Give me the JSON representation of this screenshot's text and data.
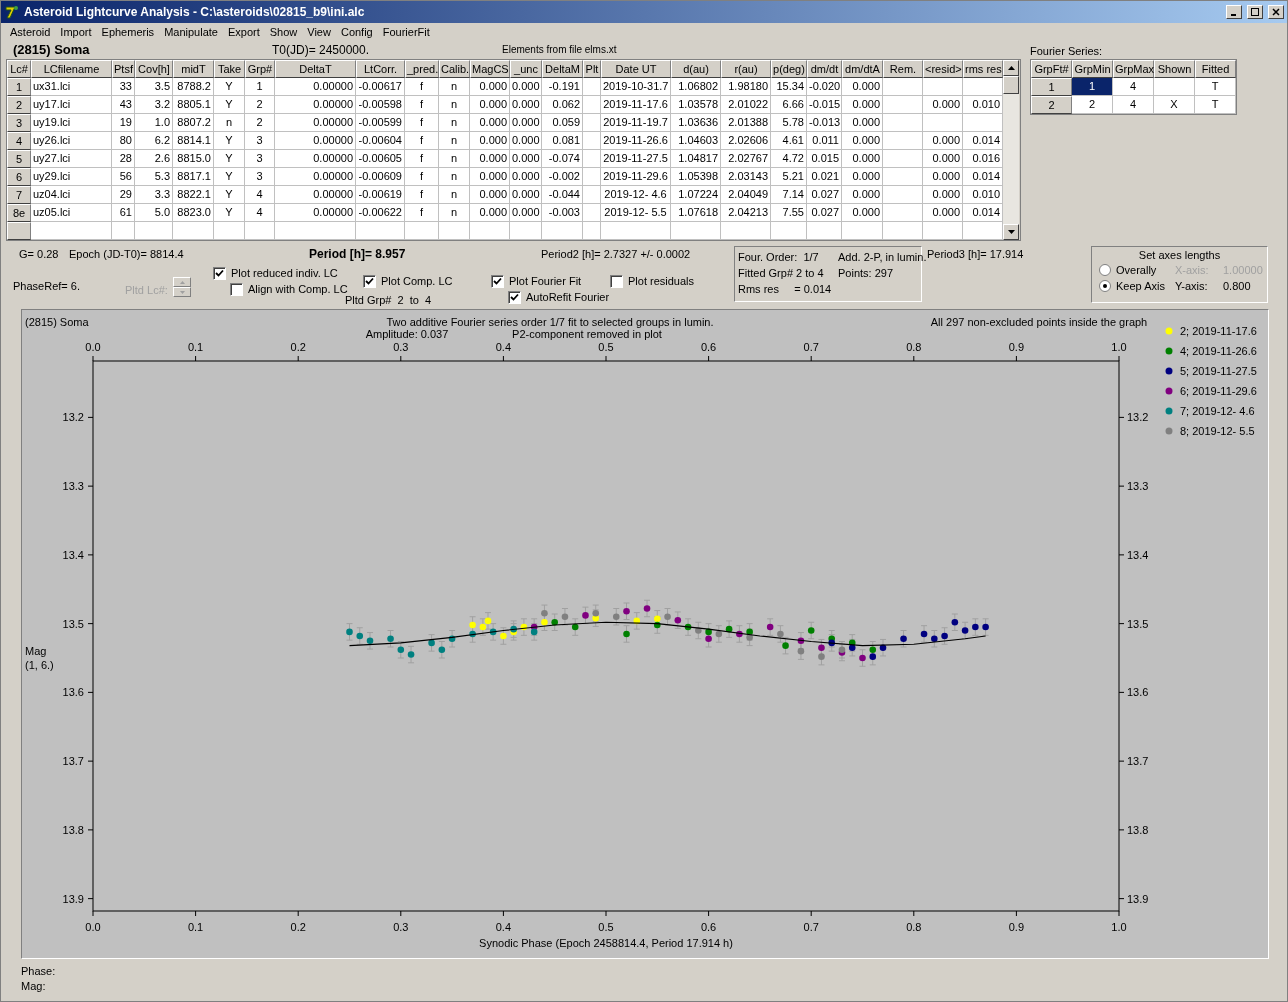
{
  "window": {
    "title": "Asteroid Lightcurve Analysis - C:\\asteroids\\02815_b9\\ini.alc"
  },
  "menu": [
    "Asteroid",
    "Import",
    "Ephemeris",
    "Manipulate",
    "Export",
    "Show",
    "View",
    "Config",
    "FourierFit"
  ],
  "header": {
    "object": "(2815) Soma",
    "t0": "T0(JD)= 2450000.",
    "elements": "Elements from file elms.xt"
  },
  "lc_table": {
    "columns": [
      "Lc#",
      "LCfilename",
      "Ptsf",
      "Cov[h]",
      "midT",
      "Take",
      "Grp#",
      "DeltaT",
      "LtCorr.",
      "_pred.",
      "Calib.",
      "MagCS",
      "_unc",
      "DeltaM",
      "Plt",
      "Date UT",
      "d(au)",
      "r(au)",
      "p(deg)",
      "dm/dt",
      "dm/dtA",
      "Rem.",
      "<resid>",
      "rms res"
    ],
    "rows": [
      {
        "cells": [
          "1",
          "ux31.lci",
          "33",
          "3.5",
          "8788.2",
          "Y",
          "1",
          "0.00000",
          "-0.00617",
          "f",
          "n",
          "0.000",
          "0.000",
          "-0.191",
          "",
          "2019-10-31.7",
          "1.06802",
          "1.98180",
          "15.34",
          "-0.020",
          "0.000",
          "",
          "",
          ""
        ]
      },
      {
        "cells": [
          "2",
          "uy17.lci",
          "43",
          "3.2",
          "8805.1",
          "Y",
          "2",
          "0.00000",
          "-0.00598",
          "f",
          "n",
          "0.000",
          "0.000",
          "0.062",
          "",
          "2019-11-17.6",
          "1.03578",
          "2.01022",
          "6.66",
          "-0.015",
          "0.000",
          "",
          "0.000",
          "0.010"
        ]
      },
      {
        "cells": [
          "3",
          "uy19.lci",
          "19",
          "1.0",
          "8807.2",
          "n",
          "2",
          "0.00000",
          "-0.00599",
          "f",
          "n",
          "0.000",
          "0.000",
          "0.059",
          "",
          "2019-11-19.7",
          "1.03636",
          "2.01388",
          "5.78",
          "-0.013",
          "0.000",
          "",
          "",
          ""
        ]
      },
      {
        "cells": [
          "4",
          "uy26.lci",
          "80",
          "6.2",
          "8814.1",
          "Y",
          "3",
          "0.00000",
          "-0.00604",
          "f",
          "n",
          "0.000",
          "0.000",
          "0.081",
          "",
          "2019-11-26.6",
          "1.04603",
          "2.02606",
          "4.61",
          "0.011",
          "0.000",
          "",
          "0.000",
          "0.014"
        ]
      },
      {
        "cells": [
          "5",
          "uy27.lci",
          "28",
          "2.6",
          "8815.0",
          "Y",
          "3",
          "0.00000",
          "-0.00605",
          "f",
          "n",
          "0.000",
          "0.000",
          "-0.074",
          "",
          "2019-11-27.5",
          "1.04817",
          "2.02767",
          "4.72",
          "0.015",
          "0.000",
          "",
          "0.000",
          "0.016"
        ]
      },
      {
        "cells": [
          "6",
          "uy29.lci",
          "56",
          "5.3",
          "8817.1",
          "Y",
          "3",
          "0.00000",
          "-0.00609",
          "f",
          "n",
          "0.000",
          "0.000",
          "-0.002",
          "",
          "2019-11-29.6",
          "1.05398",
          "2.03143",
          "5.21",
          "0.021",
          "0.000",
          "",
          "0.000",
          "0.014"
        ]
      },
      {
        "cells": [
          "7",
          "uz04.lci",
          "29",
          "3.3",
          "8822.1",
          "Y",
          "4",
          "0.00000",
          "-0.00619",
          "f",
          "n",
          "0.000",
          "0.000",
          "-0.044",
          "",
          "2019-12- 4.6",
          "1.07224",
          "2.04049",
          "7.14",
          "0.027",
          "0.000",
          "",
          "0.000",
          "0.010"
        ]
      },
      {
        "cells": [
          "8e",
          "uz05.lci",
          "61",
          "5.0",
          "8823.0",
          "Y",
          "4",
          "0.00000",
          "-0.00622",
          "f",
          "n",
          "0.000",
          "0.000",
          "-0.003",
          "",
          "2019-12- 5.5",
          "1.07618",
          "2.04213",
          "7.55",
          "0.027",
          "0.000",
          "",
          "0.000",
          "0.014"
        ]
      }
    ]
  },
  "fourier": {
    "label": "Fourier Series:",
    "columns": [
      "GrpFt#",
      "GrpMin",
      "GrpMax",
      "Shown",
      "Fitted"
    ],
    "rows": [
      {
        "cells": [
          {
            "text": "1",
            "selected": false
          },
          {
            "text": "1",
            "selected": true
          },
          {
            "text": "4",
            "selected": false
          },
          {
            "text": "",
            "selected": false
          },
          {
            "text": "T",
            "selected": false
          }
        ]
      },
      {
        "cells": [
          {
            "text": "2",
            "selected": false
          },
          {
            "text": "2",
            "selected": false
          },
          {
            "text": "4",
            "selected": false
          },
          {
            "text": "X",
            "selected": false
          },
          {
            "text": "T",
            "selected": false
          }
        ]
      }
    ]
  },
  "info": {
    "g": "G= 0.28",
    "epoch": "Epoch (JD-T0)= 8814.4",
    "period": "Period [h]= 8.957",
    "period2": "Period2 [h]= 2.7327 +/- 0.0002",
    "period3": "Period3 [h]= 17.914",
    "phase_ref": "PhaseRef= 6.",
    "pltd_lc": "Pltd Lc#:",
    "pltd_grp": "Pltd Grp#  2  to  4",
    "checks": [
      {
        "label": "Plot reduced indiv. LC",
        "checked": true
      },
      {
        "label": "Align with Comp. LC",
        "checked": false
      },
      {
        "label": "Plot Comp. LC",
        "checked": true
      },
      {
        "label": "Plot Fourier Fit",
        "checked": true
      },
      {
        "label": "AutoRefit Fourier",
        "checked": true
      },
      {
        "label": "Plot residuals",
        "checked": false
      }
    ],
    "fit_box": [
      "Four. Order:  1/7",
      "Add. 2-P, in lumin.",
      "Fitted Grp# 2 to 4",
      "Points: 297",
      "Rms res     = 0.014"
    ]
  },
  "axes_box": {
    "title": "Set axes lengths",
    "options": [
      {
        "label": "Overally",
        "selected": false
      },
      {
        "label": "Keep Axis",
        "selected": true
      }
    ],
    "x_label": "X-axis:",
    "x_value": "1.00000",
    "x_disabled": true,
    "y_label": "Y-axis:",
    "y_value": "0.800"
  },
  "plot": {
    "object": "(2815) Soma",
    "title_lines": [
      "Two additive Fourier series order 1/7 fit to selected groups in lumin.",
      "P2-component removed in plot"
    ],
    "amplitude": "Amplitude: 0.037",
    "points_note": "All 297 non-excluded points inside the graph",
    "ylabel_lines": [
      "Mag",
      "(1, 6.)"
    ],
    "chart_data": {
      "type": "scatter",
      "legend": "right",
      "xlabel": "Synodic Phase (Epoch 2458814.4, Period 17.914 h)",
      "xlim": [
        0,
        1
      ],
      "ylim": [
        13.918,
        13.118
      ],
      "xticks": [
        {
          "value": 0,
          "label": "0.0"
        },
        {
          "value": 0.1,
          "label": "0.1"
        },
        {
          "value": 0.2,
          "label": "0.2"
        },
        {
          "value": 0.3,
          "label": "0.3"
        },
        {
          "value": 0.4,
          "label": "0.4"
        },
        {
          "value": 0.5,
          "label": "0.5"
        },
        {
          "value": 0.6,
          "label": "0.6"
        },
        {
          "value": 0.7,
          "label": "0.7"
        },
        {
          "value": 0.8,
          "label": "0.8"
        },
        {
          "value": 0.9,
          "label": "0.9"
        },
        {
          "value": 1,
          "label": "1.0"
        }
      ],
      "yticks": [
        {
          "value": 13.2,
          "label": "13.2"
        },
        {
          "value": 13.3,
          "label": "13.3"
        },
        {
          "value": 13.4,
          "label": "13.4"
        },
        {
          "value": 13.5,
          "label": "13.5"
        },
        {
          "value": 13.6,
          "label": "13.6"
        },
        {
          "value": 13.7,
          "label": "13.7"
        },
        {
          "value": 13.8,
          "label": "13.8"
        },
        {
          "value": 13.9,
          "label": "13.9"
        }
      ],
      "series": [
        {
          "name": "2; 2019-11-17.6",
          "color": "#ffff00",
          "x": [
            0.37,
            0.38,
            0.385,
            0.4,
            0.41,
            0.42,
            0.44,
            0.49,
            0.53,
            0.55
          ],
          "values": [
            13.502,
            13.505,
            13.496,
            13.518,
            13.512,
            13.505,
            13.498,
            13.492,
            13.496,
            13.493
          ]
        },
        {
          "name": "4; 2019-11-26.6",
          "color": "#008000",
          "x": [
            0.45,
            0.47,
            0.52,
            0.55,
            0.58,
            0.6,
            0.62,
            0.64,
            0.675,
            0.7,
            0.72,
            0.74,
            0.76
          ],
          "values": [
            13.498,
            13.505,
            13.515,
            13.502,
            13.505,
            13.512,
            13.508,
            13.512,
            13.532,
            13.51,
            13.522,
            13.528,
            13.538
          ]
        },
        {
          "name": "5; 2019-11-27.5",
          "color": "#000080",
          "x": [
            0.72,
            0.74,
            0.76,
            0.77,
            0.79,
            0.81,
            0.82,
            0.83,
            0.84,
            0.85,
            0.86,
            0.87
          ],
          "values": [
            13.528,
            13.535,
            13.548,
            13.535,
            13.522,
            13.515,
            13.522,
            13.518,
            13.498,
            13.51,
            13.505,
            13.505
          ]
        },
        {
          "name": "6; 2019-11-29.6",
          "color": "#800080",
          "x": [
            0.43,
            0.48,
            0.52,
            0.54,
            0.57,
            0.6,
            0.63,
            0.66,
            0.69,
            0.71,
            0.73,
            0.75
          ],
          "values": [
            13.505,
            13.488,
            13.482,
            13.478,
            13.495,
            13.522,
            13.515,
            13.505,
            13.525,
            13.535,
            13.542,
            13.55
          ]
        },
        {
          "name": "7; 2019-12- 4.6",
          "color": "#008080",
          "x": [
            0.25,
            0.26,
            0.27,
            0.29,
            0.3,
            0.31,
            0.33,
            0.34,
            0.35,
            0.37,
            0.39,
            0.41,
            0.43
          ],
          "values": [
            13.512,
            13.518,
            13.525,
            13.522,
            13.538,
            13.545,
            13.528,
            13.538,
            13.522,
            13.515,
            13.512,
            13.508,
            13.512
          ]
        },
        {
          "name": "8; 2019-12- 5.5",
          "color": "#808080",
          "x": [
            0.44,
            0.46,
            0.49,
            0.51,
            0.56,
            0.59,
            0.61,
            0.64,
            0.67,
            0.69,
            0.71,
            0.73
          ],
          "values": [
            13.485,
            13.49,
            13.485,
            13.49,
            13.49,
            13.51,
            13.515,
            13.52,
            13.515,
            13.54,
            13.548,
            13.538
          ]
        },
        {
          "type": "line",
          "color": "#000000",
          "x": [
            0.25,
            0.3,
            0.35,
            0.4,
            0.45,
            0.5,
            0.55,
            0.6,
            0.65,
            0.7,
            0.75,
            0.8,
            0.85,
            0.87
          ],
          "values": [
            13.532,
            13.528,
            13.52,
            13.51,
            13.502,
            13.498,
            13.5,
            13.508,
            13.518,
            13.526,
            13.532,
            13.53,
            13.522,
            13.518
          ]
        }
      ]
    }
  },
  "status": {
    "phase": "Phase:",
    "mag": "Mag:"
  }
}
